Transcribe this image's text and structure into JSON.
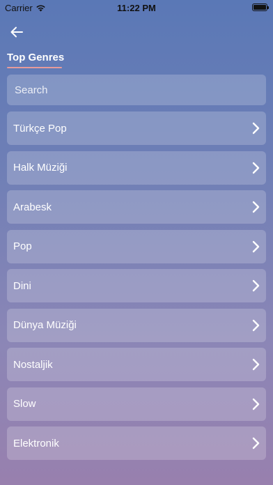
{
  "status_bar": {
    "carrier": "Carrier",
    "time": "11:22 PM"
  },
  "tabs": [
    {
      "label": "Top Genres",
      "selected": true
    }
  ],
  "search": {
    "placeholder": "Search",
    "value": ""
  },
  "genres": [
    {
      "label": "Türkçe Pop"
    },
    {
      "label": "Halk Müziği"
    },
    {
      "label": "Arabesk"
    },
    {
      "label": "Pop"
    },
    {
      "label": "Dini"
    },
    {
      "label": "Dünya Müziği"
    },
    {
      "label": "Nostaljik"
    },
    {
      "label": "Slow"
    },
    {
      "label": "Elektronik"
    }
  ],
  "icons": {
    "back": "arrow-left-icon",
    "row_chevron": "chevron-right-icon",
    "wifi": "wifi-icon",
    "battery": "battery-icon"
  },
  "colors": {
    "accent_underline": "#e79a9a",
    "background_top": "#5a78b6",
    "background_bottom": "#9880ae"
  }
}
